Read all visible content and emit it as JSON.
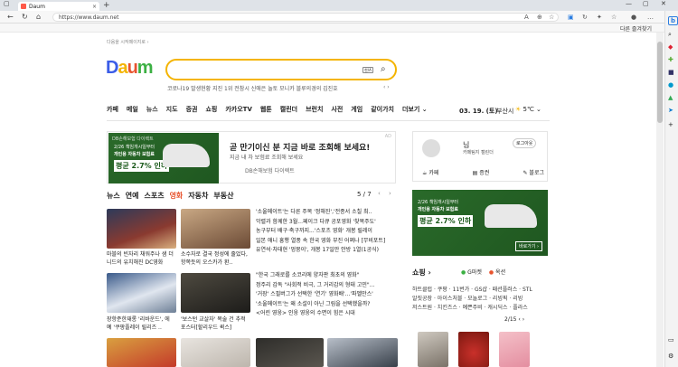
{
  "browser": {
    "tab_title": "Daum",
    "tab_close": "×",
    "new_tab": "+",
    "url": "https://www.daum.net",
    "favorites_button": "다른 즐겨찾기"
  },
  "page": {
    "set_homepage": "다음을 시작페이지로 ›",
    "logo": "Daum",
    "search_placeholder": "",
    "keyboard_label": "한/A",
    "trending": "코로나19 발생현황   지진 1위  전참시 신애은   놀토 모니카   블루의경의 김진호",
    "nav_menu": [
      "카페",
      "메일",
      "뉴스",
      "지도",
      "증권",
      "쇼핑",
      "카카오TV",
      "웹툰",
      "캘린더",
      "브런치",
      "사전",
      "게임",
      "같이가치",
      "더보기 ⌄"
    ],
    "date": "03. 19. (토)",
    "place": "부산시",
    "weather": "5℃ ⌄"
  },
  "ad1": {
    "brand_top": "DB손해보험 다이렉트",
    "line1": "2/26 책임개시일부터",
    "line2": "개인용 자동차 보험료",
    "badge": "평균 2.7% 인하",
    "headline": "곧 만기이신 분 지금 바로 조회해 보세요!",
    "sub": "지금 내 차 보험료 조회해 보세요",
    "brand": "DB손해보험 다이렉트",
    "tag": "AD"
  },
  "news": {
    "tabs": [
      "뉴스",
      "연예",
      "스포츠",
      "영화",
      "자동차",
      "부동산"
    ],
    "active_tab": "영화",
    "pager": "5 / 7",
    "row1_captions": [
      "마블의 빈자리 채워주나 샘 더니드의 유치해진 DC영화",
      "소수자로 결국 정성에 줄었다, 항쪽듯의 오스카가 환.."
    ],
    "row1_headlines": [
      "'소울메이트'는 다른 주목 '정해진','전종서 소칠 최..",
      "악렬과 함께한 3월...페이크 다큐 공포영화 '찾목주도'",
      "농구부터 배구·축구까지...'스포츠 영화' 개봉 릴레이",
      "일본 애니 흥행 열풍 속 한국 영화 부진 어쩌나 [무비포트]",
      "유연석·차태현 '멍뭉이', 개봉 17일만 안방 1열(1공식)"
    ],
    "row2_captions": [
      "장항준한재롱 '리바운드', 에 예 '쿠팡플레이 릴리즈 ..",
      "'보스턴 교살자' 목술 건 추적 포스터[할리우드 퀵스]"
    ],
    "row2_headlines": [
      "\"한국 그래로를 소코리에 양자판 최초의 영화\"",
      "정주리 감독 \"사회적 비극, 그 거리감의 형태 고민\"...",
      "'거장' 스필버그가 선택한 '연기' 영화배'...'파벨만스'",
      "'소울메이트'는 왜 소설이 아닌 그림을 선택했을까?",
      "<어린 영웅> 인웅 영웅의 수면이 힘은 시대"
    ]
  },
  "profile": {
    "name": "님",
    "login": "로그아웃",
    "links": "카페팀지  캘린더",
    "bottom": [
      "카페",
      "증권",
      "블로그"
    ]
  },
  "ad2": {
    "line1": "2/26 책임개시일부터",
    "line2": "개인용 자동차 보험료",
    "badge": "평균 2.7% 인하",
    "button": "바로가기 ›"
  },
  "shopping": {
    "title": "쇼핑 ›",
    "tabs": [
      "G마켓",
      "옥션"
    ],
    "links": [
      "하트클럽 · 쿠팡 · 11번가 · GS샵 · 패션플러스 · STL",
      "알짓공장 · 아이스처블 · 모놀로그 · 리빙픽 · 리빙",
      "저스트원 · 치킨즈스 · 예쁜주비 · 캐시딕스 · 플라스"
    ],
    "page": "2/15 ‹ ›"
  },
  "colors": {
    "accent": "#e8542f",
    "search_border": "#f4b400",
    "ad_green": "#1f5720"
  }
}
